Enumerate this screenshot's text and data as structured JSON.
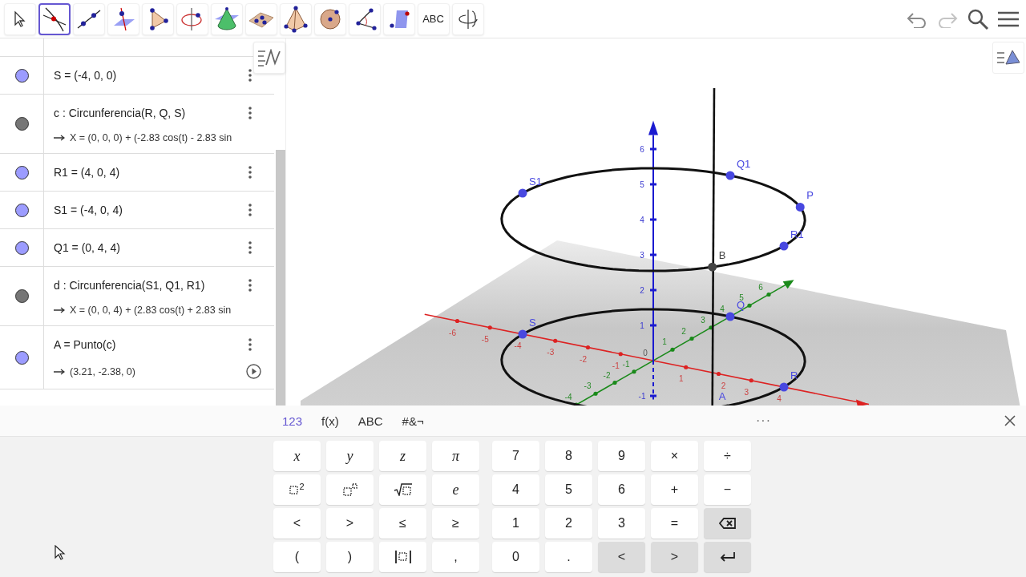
{
  "toolbar": {
    "tools": [
      {
        "kind": "move",
        "selected": false
      },
      {
        "kind": "intersect",
        "selected": true
      },
      {
        "kind": "line",
        "selected": false
      },
      {
        "kind": "perpendicular",
        "selected": false
      },
      {
        "kind": "polygon",
        "selected": false
      },
      {
        "kind": "rotate-circle",
        "selected": false
      },
      {
        "kind": "cone",
        "selected": false
      },
      {
        "kind": "plane",
        "selected": false
      },
      {
        "kind": "pyramid",
        "selected": false
      },
      {
        "kind": "sphere",
        "selected": false
      },
      {
        "kind": "angle",
        "selected": false
      },
      {
        "kind": "reflect",
        "selected": false
      },
      {
        "kind": "text",
        "label": "ABC",
        "selected": false
      },
      {
        "kind": "view-rotate",
        "selected": false
      }
    ],
    "actions": [
      {
        "kind": "undo"
      },
      {
        "kind": "redo"
      },
      {
        "kind": "search"
      },
      {
        "kind": "menu"
      }
    ]
  },
  "algebra": {
    "rows": [
      {
        "kind": "plain",
        "color": "#9c9cff",
        "definition": "S = (-4, 0, 0)"
      },
      {
        "kind": "plain",
        "color": "#767676",
        "definition": "c : Circunferencia(R, Q, S)",
        "output": "X = (0, 0, 0) + (-2.83 cos(t) - 2.83 sin"
      },
      {
        "kind": "plain",
        "color": "#9c9cff",
        "definition": "R1 = (4, 0, 4)"
      },
      {
        "kind": "plain",
        "color": "#9c9cff",
        "definition": "S1 = (-4, 0, 4)"
      },
      {
        "kind": "plain",
        "color": "#9c9cff",
        "definition": "Q1 = (0, 4, 4)"
      },
      {
        "kind": "plain",
        "color": "#767676",
        "definition": "d : Circunferencia(S1, Q1, R1)",
        "output": "X = (0, 0, 4) + (2.83 cos(t) + 2.83 sin"
      },
      {
        "kind": "animatable",
        "color": "#9c9cff",
        "definition": "A = Punto(c)",
        "output": "(3.21, -2.38, 0)"
      }
    ]
  },
  "graphics": {
    "x_ticks": [
      "-6",
      "-5",
      "-4",
      "-3",
      "-2",
      "-1",
      "1",
      "2",
      "3",
      "4"
    ],
    "y_ticks": [
      "-4",
      "-3",
      "-2",
      "-1",
      "1",
      "2",
      "3",
      "4",
      "5",
      "6"
    ],
    "z_ticks": [
      "6",
      "5",
      "4",
      "3",
      "2",
      "1",
      "-1"
    ],
    "origin": "0",
    "points": [
      {
        "label": "S1",
        "color": "#4848e0"
      },
      {
        "label": "Q1",
        "color": "#4848e0"
      },
      {
        "label": "P",
        "color": "#4848e0"
      },
      {
        "label": "R1",
        "color": "#4848e0"
      },
      {
        "label": "B",
        "color": "#444444"
      },
      {
        "label": "Q",
        "color": "#4848e0"
      },
      {
        "label": "S",
        "color": "#4848e0"
      },
      {
        "label": "R",
        "color": "#4848e0"
      },
      {
        "label": "A",
        "color": "#4848e0"
      }
    ]
  },
  "keyboard": {
    "tabs": [
      {
        "label": "123",
        "selected": true
      },
      {
        "label": "f(x)",
        "selected": false
      },
      {
        "label": "ABC",
        "selected": false
      },
      {
        "label": "#&¬",
        "selected": false
      }
    ],
    "more": "···",
    "left_keys": [
      {
        "kind": "var",
        "label": "x"
      },
      {
        "kind": "var",
        "label": "y"
      },
      {
        "kind": "var",
        "label": "z"
      },
      {
        "kind": "var",
        "label": "π"
      },
      {
        "kind": "square",
        "label": "2"
      },
      {
        "kind": "power"
      },
      {
        "kind": "sqrt"
      },
      {
        "kind": "var",
        "label": "e"
      },
      {
        "kind": "char",
        "label": "<"
      },
      {
        "kind": "char",
        "label": ">"
      },
      {
        "kind": "char",
        "label": "≤"
      },
      {
        "kind": "char",
        "label": "≥"
      },
      {
        "kind": "char",
        "label": "("
      },
      {
        "kind": "char",
        "label": ")"
      },
      {
        "kind": "abs"
      },
      {
        "kind": "char",
        "label": ","
      }
    ],
    "right_keys": [
      {
        "kind": "char",
        "label": "7"
      },
      {
        "kind": "char",
        "label": "8"
      },
      {
        "kind": "char",
        "label": "9"
      },
      {
        "kind": "char",
        "label": "×"
      },
      {
        "kind": "char",
        "label": "÷"
      },
      {
        "kind": "char",
        "label": "4"
      },
      {
        "kind": "char",
        "label": "5"
      },
      {
        "kind": "char",
        "label": "6"
      },
      {
        "kind": "char",
        "label": "+"
      },
      {
        "kind": "char",
        "label": "−"
      },
      {
        "kind": "char",
        "label": "1"
      },
      {
        "kind": "char",
        "label": "2"
      },
      {
        "kind": "char",
        "label": "3"
      },
      {
        "kind": "char",
        "label": "="
      },
      {
        "kind": "backspace"
      },
      {
        "kind": "char",
        "label": "0"
      },
      {
        "kind": "char",
        "label": "."
      },
      {
        "kind": "nav",
        "label": "<"
      },
      {
        "kind": "nav",
        "label": ">"
      },
      {
        "kind": "enter"
      }
    ]
  }
}
